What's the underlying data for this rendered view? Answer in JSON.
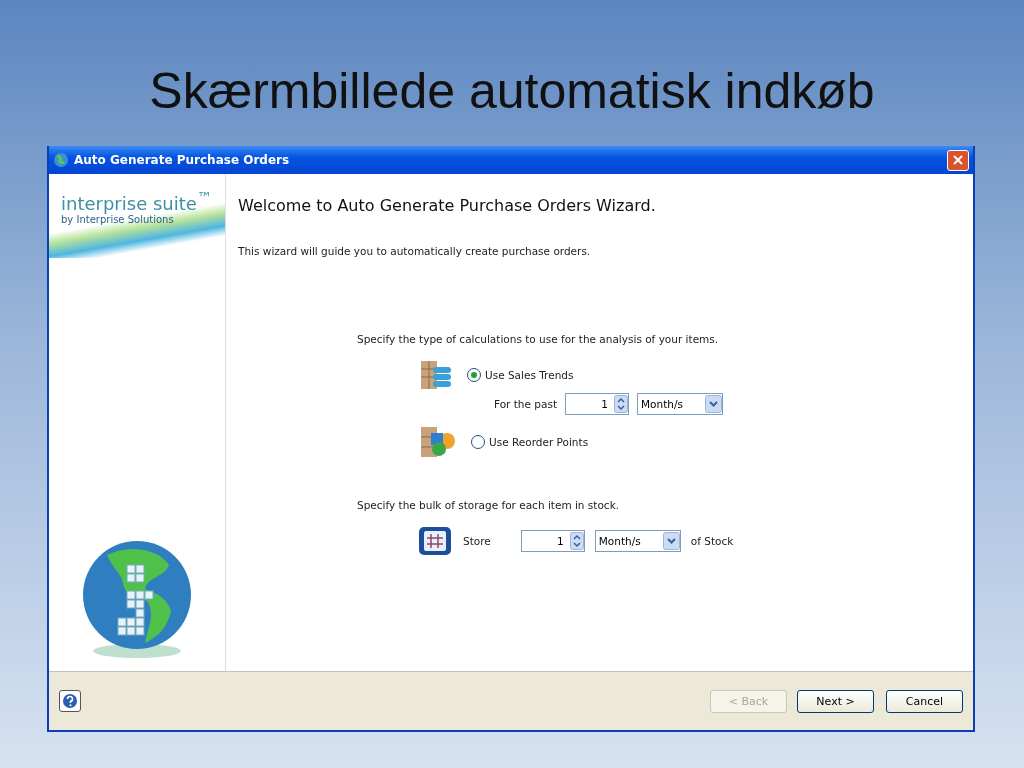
{
  "slide": {
    "title": "Skærmbillede automatisk indkøb"
  },
  "window": {
    "title": "Auto Generate Purchase Orders"
  },
  "logo": {
    "name": "interprise suite$^{™}$",
    "tagline": "by Interprise Solutions"
  },
  "wizard": {
    "heading": "Welcome to Auto Generate Purchase Orders Wizard.",
    "intro": "This wizard will guide you to automatically create purchase orders.",
    "calc_prompt": "Specify the type of calculations to use for the analysis of your items.",
    "options": [
      {
        "kind": "trends",
        "label": "Use Sales Trends",
        "selected": true,
        "period": {
          "label": "For the past",
          "value": "1",
          "unit": "Month/s"
        }
      },
      {
        "kind": "reorder",
        "label": "Use Reorder Points",
        "selected": false
      }
    ],
    "storage_prompt": "Specify the bulk of storage for each item in stock.",
    "storage": {
      "label": "Store",
      "value": "1",
      "unit": "Month/s",
      "suffix": "of Stock"
    }
  },
  "buttons": [
    {
      "label": "< Back",
      "disabled": true
    },
    {
      "label": "Next >",
      "disabled": false
    },
    {
      "label": "Cancel",
      "disabled": false
    }
  ]
}
